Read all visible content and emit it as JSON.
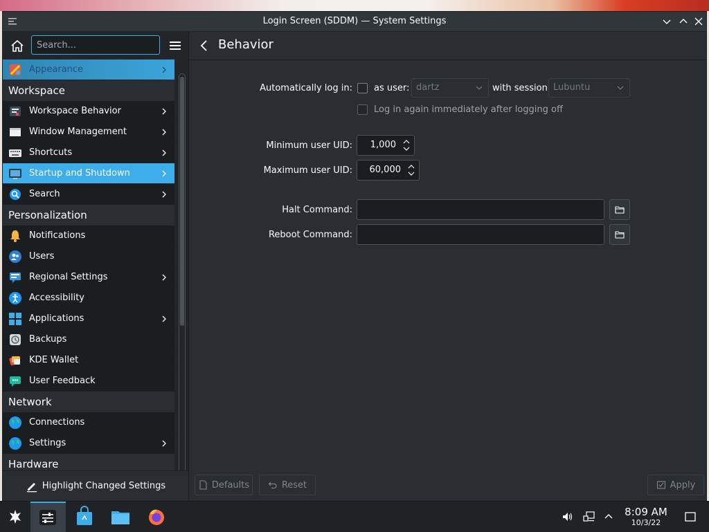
{
  "window": {
    "title": "Login Screen (SDDM) — System Settings"
  },
  "sidebar": {
    "search_placeholder": "Search...",
    "items": [
      {
        "type": "item",
        "label": "Appearance",
        "icon": "appearance-icon",
        "chevron": true,
        "state": "active-top"
      },
      {
        "type": "section",
        "label": "Workspace"
      },
      {
        "type": "item",
        "label": "Workspace Behavior",
        "icon": "workspace-behavior-icon",
        "chevron": true
      },
      {
        "type": "item",
        "label": "Window Management",
        "icon": "window-management-icon",
        "chevron": true
      },
      {
        "type": "item",
        "label": "Shortcuts",
        "icon": "keyboard-icon",
        "chevron": true
      },
      {
        "type": "item",
        "label": "Startup and Shutdown",
        "icon": "startup-shutdown-icon",
        "chevron": true,
        "state": "active"
      },
      {
        "type": "item",
        "label": "Search",
        "icon": "search-icon",
        "chevron": true
      },
      {
        "type": "section",
        "label": "Personalization"
      },
      {
        "type": "item",
        "label": "Notifications",
        "icon": "bell-icon",
        "chevron": false
      },
      {
        "type": "item",
        "label": "Users",
        "icon": "users-icon",
        "chevron": false
      },
      {
        "type": "item",
        "label": "Regional Settings",
        "icon": "regional-settings-icon",
        "chevron": true
      },
      {
        "type": "item",
        "label": "Accessibility",
        "icon": "accessibility-icon",
        "chevron": false
      },
      {
        "type": "item",
        "label": "Applications",
        "icon": "applications-icon",
        "chevron": true
      },
      {
        "type": "item",
        "label": "Backups",
        "icon": "backups-icon",
        "chevron": false
      },
      {
        "type": "item",
        "label": "KDE Wallet",
        "icon": "wallet-icon",
        "chevron": false
      },
      {
        "type": "item",
        "label": "User Feedback",
        "icon": "feedback-icon",
        "chevron": false
      },
      {
        "type": "section",
        "label": "Network"
      },
      {
        "type": "item",
        "label": "Connections",
        "icon": "globe-icon",
        "chevron": false
      },
      {
        "type": "item",
        "label": "Settings",
        "icon": "network-settings-icon",
        "chevron": true
      },
      {
        "type": "section",
        "label": "Hardware"
      }
    ],
    "highlight_button": "Highlight Changed Settings"
  },
  "content": {
    "page_title": "Behavior",
    "autologin": {
      "label": "Automatically log in:",
      "as_user_label": "as user:",
      "user_value": "dartz",
      "with_session_label": "with session",
      "session_value": "Lubuntu",
      "relogin_label": "Log in again immediately after logging off"
    },
    "min_uid": {
      "label": "Minimum user UID:",
      "value": "1,000"
    },
    "max_uid": {
      "label": "Maximum user UID:",
      "value": "60,000"
    },
    "halt": {
      "label": "Halt Command:",
      "value": ""
    },
    "reboot": {
      "label": "Reboot Command:",
      "value": ""
    },
    "buttons": {
      "defaults": "Defaults",
      "reset": "Reset",
      "apply": "Apply"
    }
  },
  "taskbar": {
    "time": "8:09 AM",
    "date": "10/3/22"
  },
  "colors": {
    "accent": "#3daee9",
    "window_bg": "#2a2e32",
    "sidebar_bg": "#1b1e20"
  }
}
